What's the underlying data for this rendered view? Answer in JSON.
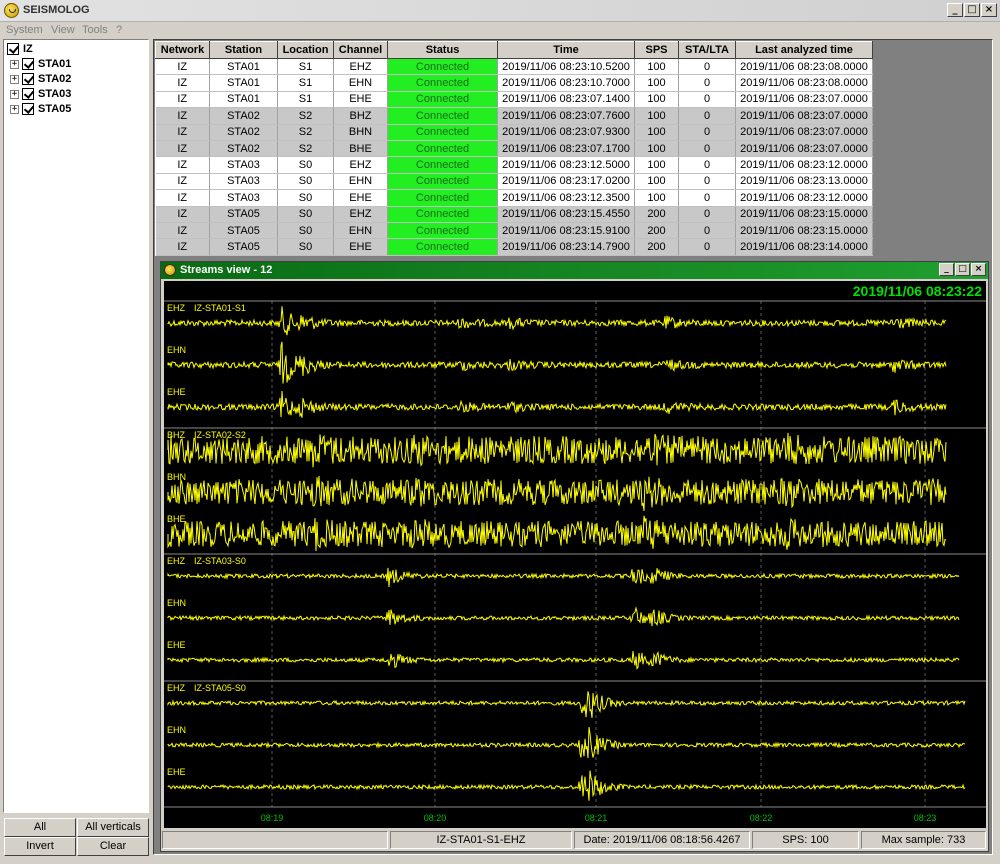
{
  "window": {
    "title": "SEISMOLOG",
    "minimize": "_",
    "maximize": "□",
    "close": "×"
  },
  "menu": [
    "System",
    "View",
    "Tools",
    "?"
  ],
  "tree": {
    "root": {
      "label": "IZ",
      "checked": true
    },
    "children": [
      {
        "label": "STA01",
        "checked": true,
        "expander": "+"
      },
      {
        "label": "STA02",
        "checked": true,
        "expander": "+"
      },
      {
        "label": "STA03",
        "checked": true,
        "expander": "+"
      },
      {
        "label": "STA05",
        "checked": true,
        "expander": "+"
      }
    ]
  },
  "buttons": {
    "all": "All",
    "all_verticals": "All verticals",
    "invert": "Invert",
    "clear": "Clear"
  },
  "table": {
    "headers": [
      "Network",
      "Station",
      "Location",
      "Channel",
      "Status",
      "Time",
      "SPS",
      "STA/LTA",
      "Last analyzed time"
    ],
    "rows": [
      [
        "IZ",
        "STA01",
        "S1",
        "EHZ",
        "Connected",
        "2019/11/06 08:23:10.5200",
        "100",
        "0",
        "2019/11/06 08:23:08.0000"
      ],
      [
        "IZ",
        "STA01",
        "S1",
        "EHN",
        "Connected",
        "2019/11/06 08:23:10.7000",
        "100",
        "0",
        "2019/11/06 08:23:08.0000"
      ],
      [
        "IZ",
        "STA01",
        "S1",
        "EHE",
        "Connected",
        "2019/11/06 08:23:07.1400",
        "100",
        "0",
        "2019/11/06 08:23:07.0000"
      ],
      [
        "IZ",
        "STA02",
        "S2",
        "BHZ",
        "Connected",
        "2019/11/06 08:23:07.7600",
        "100",
        "0",
        "2019/11/06 08:23:07.0000"
      ],
      [
        "IZ",
        "STA02",
        "S2",
        "BHN",
        "Connected",
        "2019/11/06 08:23:07.9300",
        "100",
        "0",
        "2019/11/06 08:23:07.0000"
      ],
      [
        "IZ",
        "STA02",
        "S2",
        "BHE",
        "Connected",
        "2019/11/06 08:23:07.1700",
        "100",
        "0",
        "2019/11/06 08:23:07.0000"
      ],
      [
        "IZ",
        "STA03",
        "S0",
        "EHZ",
        "Connected",
        "2019/11/06 08:23:12.5000",
        "100",
        "0",
        "2019/11/06 08:23:12.0000"
      ],
      [
        "IZ",
        "STA03",
        "S0",
        "EHN",
        "Connected",
        "2019/11/06 08:23:17.0200",
        "100",
        "0",
        "2019/11/06 08:23:13.0000"
      ],
      [
        "IZ",
        "STA03",
        "S0",
        "EHE",
        "Connected",
        "2019/11/06 08:23:12.3500",
        "100",
        "0",
        "2019/11/06 08:23:12.0000"
      ],
      [
        "IZ",
        "STA05",
        "S0",
        "EHZ",
        "Connected",
        "2019/11/06 08:23:15.4550",
        "200",
        "0",
        "2019/11/06 08:23:15.0000"
      ],
      [
        "IZ",
        "STA05",
        "S0",
        "EHN",
        "Connected",
        "2019/11/06 08:23:15.9100",
        "200",
        "0",
        "2019/11/06 08:23:15.0000"
      ],
      [
        "IZ",
        "STA05",
        "S0",
        "EHE",
        "Connected",
        "2019/11/06 08:23:14.7900",
        "200",
        "0",
        "2019/11/06 08:23:14.0000"
      ]
    ]
  },
  "streams": {
    "title": "Streams view - 12",
    "clock": "2019/11/06 08:23:22",
    "groups": [
      {
        "station": "IZ-STA01-S1",
        "channels": [
          "EHZ",
          "EHN",
          "EHE"
        ]
      },
      {
        "station": "IZ-STA02-S2",
        "channels": [
          "BHZ",
          "BHN",
          "BHE"
        ]
      },
      {
        "station": "IZ-STA03-S0",
        "channels": [
          "EHZ",
          "EHN",
          "EHE"
        ]
      },
      {
        "station": "IZ-STA05-S0",
        "channels": [
          "EHZ",
          "EHN",
          "EHE"
        ]
      }
    ],
    "time_ticks": [
      "08:19",
      "08:20",
      "08:21",
      "08:22",
      "08:23"
    ],
    "statusbar": {
      "stream": "IZ-STA01-S1-EHZ",
      "date": "Date: 2019/11/06 08:18:56.4267",
      "sps": "SPS: 100",
      "max_sample": "Max sample: 733"
    }
  },
  "colors": {
    "trace": "#ffff00",
    "clock": "#00e000",
    "connected": "#22ee22",
    "tick": "#00c000"
  }
}
